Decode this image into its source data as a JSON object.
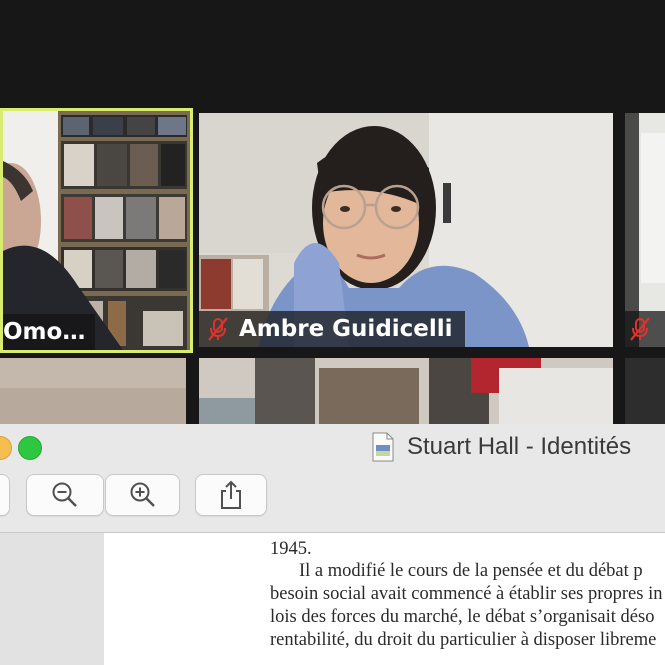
{
  "zoom": {
    "participants": [
      {
        "name": "Omo…",
        "active_speaker": true,
        "muted": false
      },
      {
        "name": "Ambre Guidicelli",
        "active_speaker": false,
        "muted": true
      },
      {
        "name": "",
        "active_speaker": false,
        "muted": true
      }
    ],
    "colors": {
      "active_border": "#d9ec6d",
      "mute_red": "#e0322c"
    }
  },
  "preview": {
    "window_title": "Stuart Hall - Identités",
    "toolbar": {
      "zoom_out_icon": "zoom-out-icon",
      "zoom_in_icon": "zoom-in-icon",
      "share_icon": "share-icon"
    },
    "page_lines": [
      "1945.",
      "Il a modifié le cours de la pensée et du débat p",
      "besoin social avait commencé à établir ses propres in",
      "lois des forces du marché, le débat s’organisait déso",
      "rentabilité, du droit du particulier à disposer libreme"
    ]
  }
}
